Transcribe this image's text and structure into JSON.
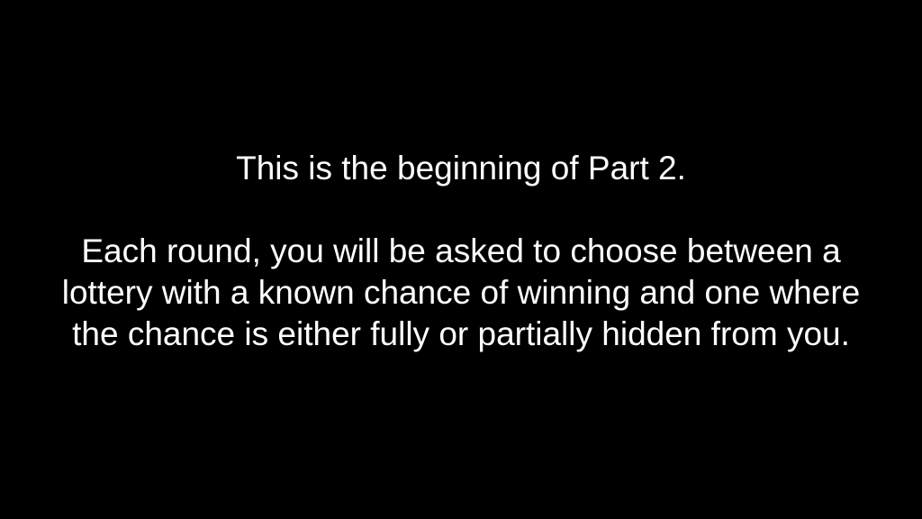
{
  "screen": {
    "background_color": "#000000",
    "text_color": "#ffffff",
    "heading": "This is the beginning of Part 2.",
    "body": "Each round, you will be asked to choose between a lottery with a known chance of winning and one where the chance is either fully or partially hidden from you."
  }
}
